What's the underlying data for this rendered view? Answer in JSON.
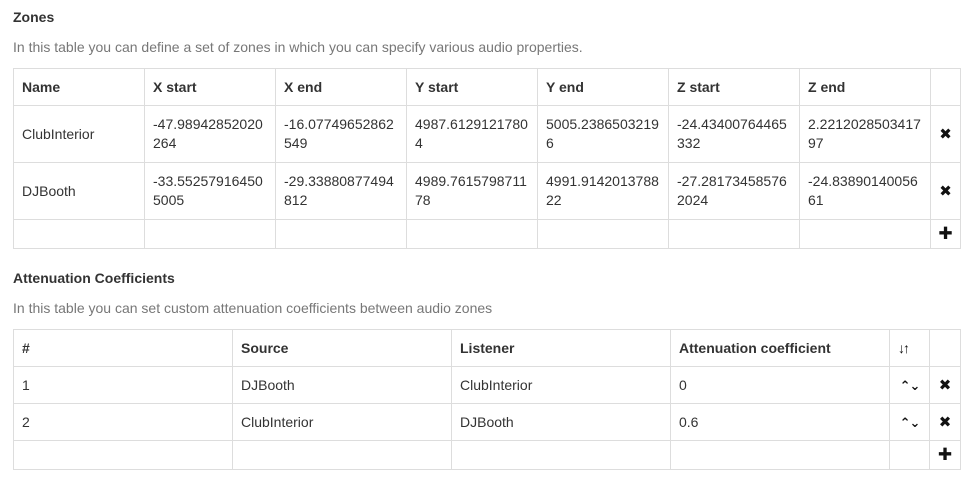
{
  "zones": {
    "title": "Zones",
    "description": "In this table you can define a set of zones in which you can specify various audio properties.",
    "columns": [
      "Name",
      "X start",
      "X end",
      "Y start",
      "Y end",
      "Z start",
      "Z end"
    ],
    "rows": [
      [
        "ClubInterior",
        "-47.98942852020264",
        "-16.07749652862549",
        "4987.6129121780 4",
        "5005.2386503219 6",
        "-24.43400764465332",
        "2.221202850341797"
      ],
      [
        "DJBooth",
        "-33.55257916450 5005",
        "-29.33880877494812",
        "4989.7615798711 78",
        "4991.9142013788 22",
        "-27.28173458576 2024",
        "-24.83890140056 61"
      ]
    ]
  },
  "attenuation": {
    "title": "Attenuation Coefficients",
    "description": "In this table you can set custom attenuation coefficients between audio zones",
    "columns": [
      "#",
      "Source",
      "Listener",
      "Attenuation coefficient"
    ],
    "rows": [
      [
        "1",
        "DJBooth",
        "ClubInterior",
        "0"
      ],
      [
        "2",
        "ClubInterior",
        "DJBooth",
        "0.6"
      ]
    ]
  },
  "icons": {
    "remove": "✖",
    "add": "✚",
    "sort": "↓↑",
    "move": "⌃⌄"
  }
}
